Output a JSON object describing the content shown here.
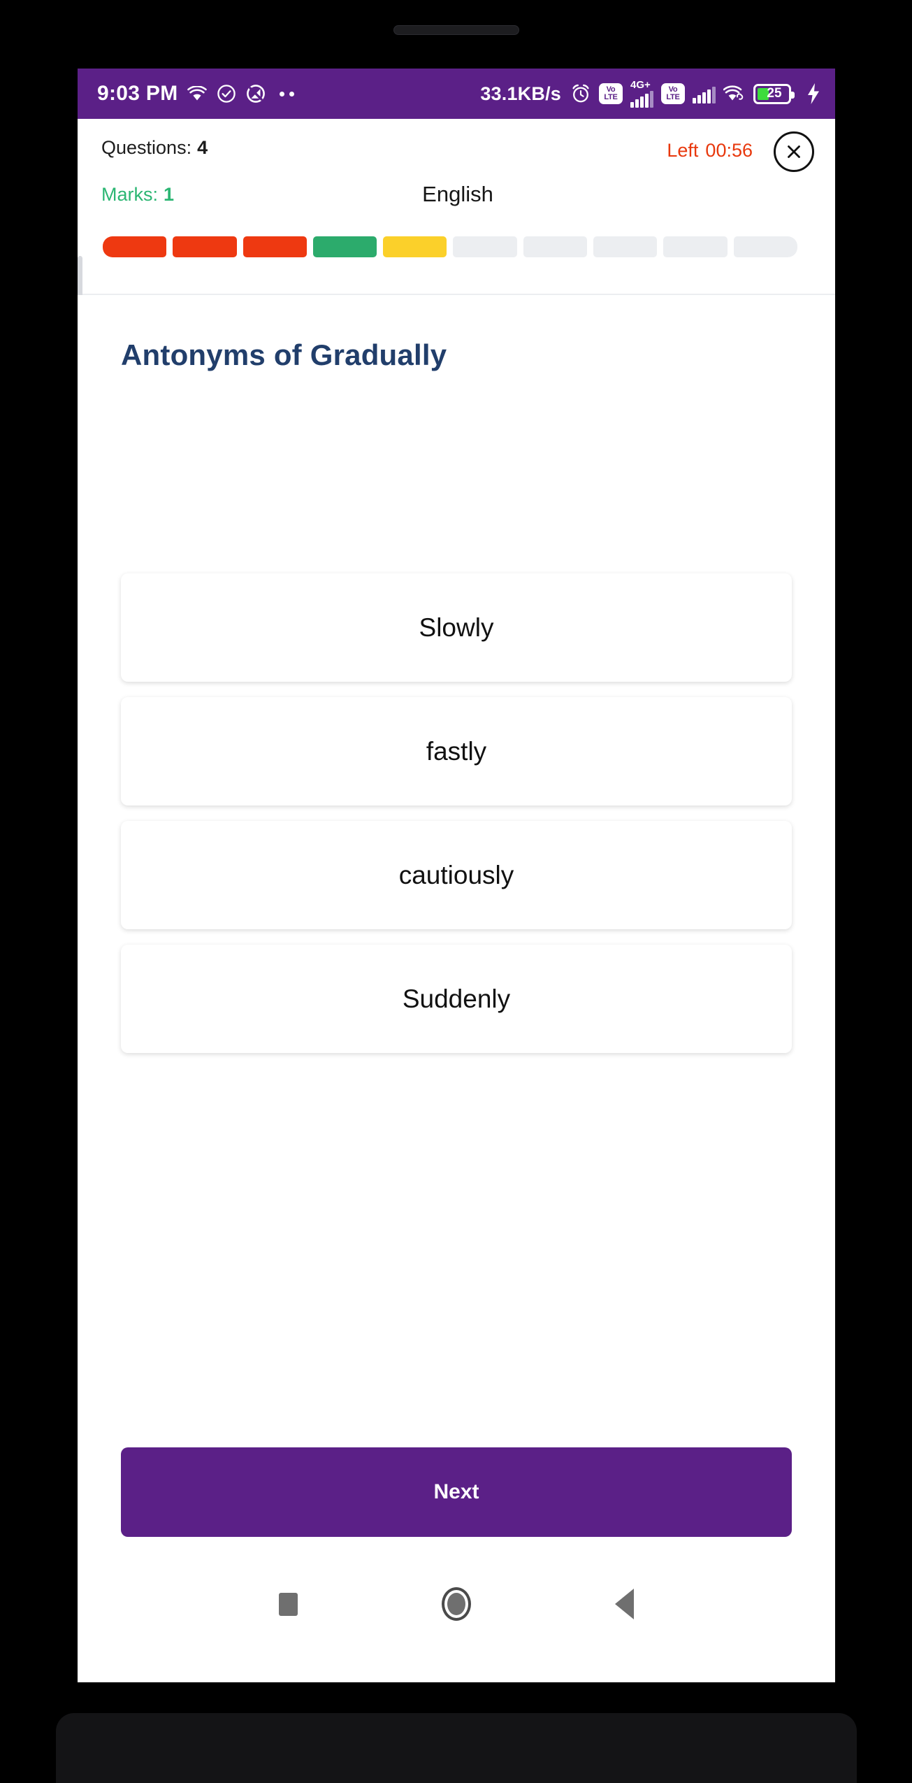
{
  "status_bar": {
    "time": "9:03 PM",
    "network_speed": "33.1KB/s",
    "battery_level": "25",
    "volte_top": "Vo",
    "volte_bottom": "LTE",
    "signal_label_1": "4G+",
    "icons": [
      "wifi-icon",
      "check-circle-icon",
      "do-not-disturb-icon",
      "more-dots-icon",
      "alarm-clock-icon",
      "volte-icon",
      "signal-bars-icon",
      "volte-icon",
      "signal-bars-icon",
      "wifi-link-icon",
      "battery-icon",
      "charging-bolt-icon"
    ],
    "accent_bg": "#5b2087"
  },
  "header": {
    "questions_label": "Questions:",
    "questions_value": "4",
    "marks_label": "Marks:",
    "marks_value": "1",
    "subject": "English",
    "timer_label": "Left",
    "timer_value": "00:56",
    "close_label": "Close",
    "marks_color": "#2cb673",
    "timer_color": "#e8380d"
  },
  "progress": {
    "total": 10,
    "segments": [
      {
        "index": 1,
        "state": "wrong",
        "color": "#ee3911"
      },
      {
        "index": 2,
        "state": "wrong",
        "color": "#ee3911"
      },
      {
        "index": 3,
        "state": "wrong",
        "color": "#ee3911"
      },
      {
        "index": 4,
        "state": "correct",
        "color": "#2cab6c"
      },
      {
        "index": 5,
        "state": "skipped",
        "color": "#fbd02a"
      },
      {
        "index": 6,
        "state": "pending",
        "color": "#eceef1"
      },
      {
        "index": 7,
        "state": "pending",
        "color": "#eceef1"
      },
      {
        "index": 8,
        "state": "pending",
        "color": "#eceef1"
      },
      {
        "index": 9,
        "state": "pending",
        "color": "#eceef1"
      },
      {
        "index": 10,
        "state": "pending",
        "color": "#eceef1"
      }
    ]
  },
  "question": {
    "text": "Antonyms of Gradually",
    "text_color": "#213e6b",
    "options": [
      {
        "id": "a",
        "label": "Slowly"
      },
      {
        "id": "b",
        "label": "fastly"
      },
      {
        "id": "c",
        "label": "cautiously"
      },
      {
        "id": "d",
        "label": "Suddenly"
      }
    ]
  },
  "actions": {
    "next_label": "Next",
    "next_color": "#5b2087"
  },
  "nav_bar": {
    "recent_label": "Recents",
    "home_label": "Home",
    "back_label": "Back"
  }
}
